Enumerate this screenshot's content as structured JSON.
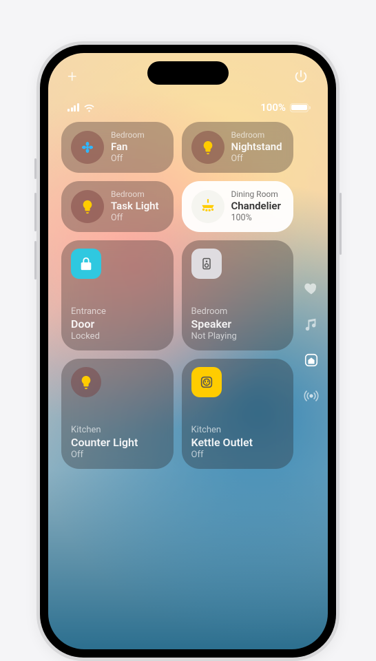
{
  "top": {
    "add": "+",
    "power": "power-icon"
  },
  "status": {
    "battery_pct": "100%",
    "battery_fill": 100
  },
  "tiles": {
    "fan": {
      "room": "Bedroom",
      "name": "Fan",
      "status": "Off",
      "icon_color": "#2fb8ff"
    },
    "nightstand": {
      "room": "Bedroom",
      "name": "Nightstand",
      "status": "Off",
      "icon_color": "#ffcc00"
    },
    "tasklight": {
      "room": "Bedroom",
      "name": "Task Light",
      "status": "Off",
      "icon_color": "#ffcc00"
    },
    "chandelier": {
      "room": "Dining Room",
      "name": "Chandelier",
      "status": "100%",
      "icon_color": "#ffcc00",
      "on": true
    },
    "door": {
      "room": "Entrance",
      "name": "Door",
      "status": "Locked",
      "icon_color": "#ffffff"
    },
    "speaker": {
      "room": "Bedroom",
      "name": "Speaker",
      "status": "Not Playing",
      "icon_color": "#555"
    },
    "counter": {
      "room": "Kitchen",
      "name": "Counter Light",
      "status": "Off",
      "icon_color": "#ffcc00"
    },
    "kettle": {
      "room": "Kitchen",
      "name": "Kettle Outlet",
      "status": "Off",
      "icon_color": "#555"
    }
  }
}
